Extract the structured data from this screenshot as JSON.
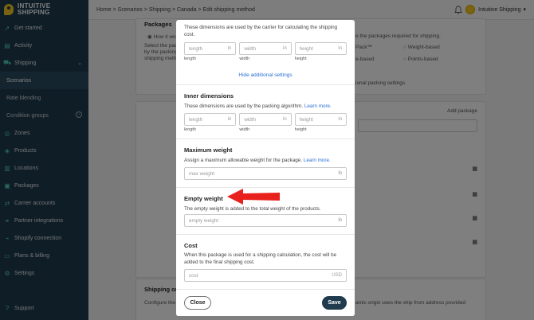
{
  "app": {
    "logo_line1": "INTUITIVE",
    "logo_line2": "SHIPPING",
    "accent_color": "#4fd1b5",
    "sidebar_color": "#1f3b4d"
  },
  "sidebar": {
    "items": [
      {
        "label": "Get started",
        "icon": "rocket-icon"
      },
      {
        "label": "Activity",
        "icon": "activity-icon"
      },
      {
        "label": "Shipping",
        "icon": "truck-icon"
      },
      {
        "label": "Scenarios",
        "icon": ""
      },
      {
        "label": "Rate blending",
        "icon": ""
      },
      {
        "label": "Condition groups",
        "icon": ""
      },
      {
        "label": "Zones",
        "icon": "globe-icon"
      },
      {
        "label": "Products",
        "icon": "box-icon"
      },
      {
        "label": "Locations",
        "icon": "pin-icon"
      },
      {
        "label": "Packages",
        "icon": "package-icon"
      },
      {
        "label": "Carrier accounts",
        "icon": "carrier-icon"
      },
      {
        "label": "Partner integrations",
        "icon": "link-icon"
      },
      {
        "label": "Shopify connection",
        "icon": "plug-icon"
      },
      {
        "label": "Plans & billing",
        "icon": "card-icon"
      },
      {
        "label": "Settings",
        "icon": "gear-icon"
      }
    ],
    "support": "Support"
  },
  "topbar": {
    "breadcrumb": "Home > Scenarios > Shipping > Canada > Edit shipping method",
    "account": "Intuitive Shipping"
  },
  "background": {
    "packages_title": "Packages",
    "how_it_works": "How it work",
    "packages_desc_1": "Select the pack",
    "packages_desc_2": "by the packing",
    "packages_desc_3": "shipping metho",
    "right_desc": "e the packages required for shipping.",
    "opt_pack": "Pack™",
    "opt_weight": "Weight-based",
    "opt_e_based": "e-based",
    "opt_points": "Points-based",
    "additional_packing": "ional packing settings",
    "add_package": "Add package",
    "shipping_origin": "Shipping origi",
    "configure": "Configure the c",
    "origin_right": "amic origin uses the ship from address provided"
  },
  "modal": {
    "top_desc_1": "These dimensions are used by the carrier for calculating the shipping",
    "top_desc_2": "cost.",
    "outer": {
      "length_ph": "length",
      "width_ph": "width",
      "height_ph": "height",
      "unit": "in",
      "length_label": "length",
      "width_label": "width",
      "height_label": "height"
    },
    "hide_additional": "Hide additional settings",
    "inner": {
      "title": "Inner dimensions",
      "desc": "These dimensions are used by the packing algorithm.",
      "learn_more": "Learn more.",
      "length_ph": "length",
      "width_ph": "width",
      "height_ph": "height",
      "unit": "in",
      "length_label": "length",
      "width_label": "width",
      "height_label": "height"
    },
    "max_weight": {
      "title": "Maximum weight",
      "desc": "Assign a maximum allowable weight for the package.",
      "learn_more": "Learn more.",
      "placeholder": "max weight",
      "unit": "lb"
    },
    "empty_weight": {
      "title": "Empty weight",
      "desc": "The empty weight is added to the total weight of the products.",
      "placeholder": "empty weight",
      "unit": "lb"
    },
    "cost": {
      "title": "Cost",
      "desc_1": "When this package is used for a shipping calculation, the cost will be",
      "desc_2": "added to the final shipping cost.",
      "placeholder": "cost",
      "unit": "USD"
    },
    "close_label": "Close",
    "save_label": "Save"
  },
  "annotation": {
    "arrow_color": "#e8211d"
  }
}
